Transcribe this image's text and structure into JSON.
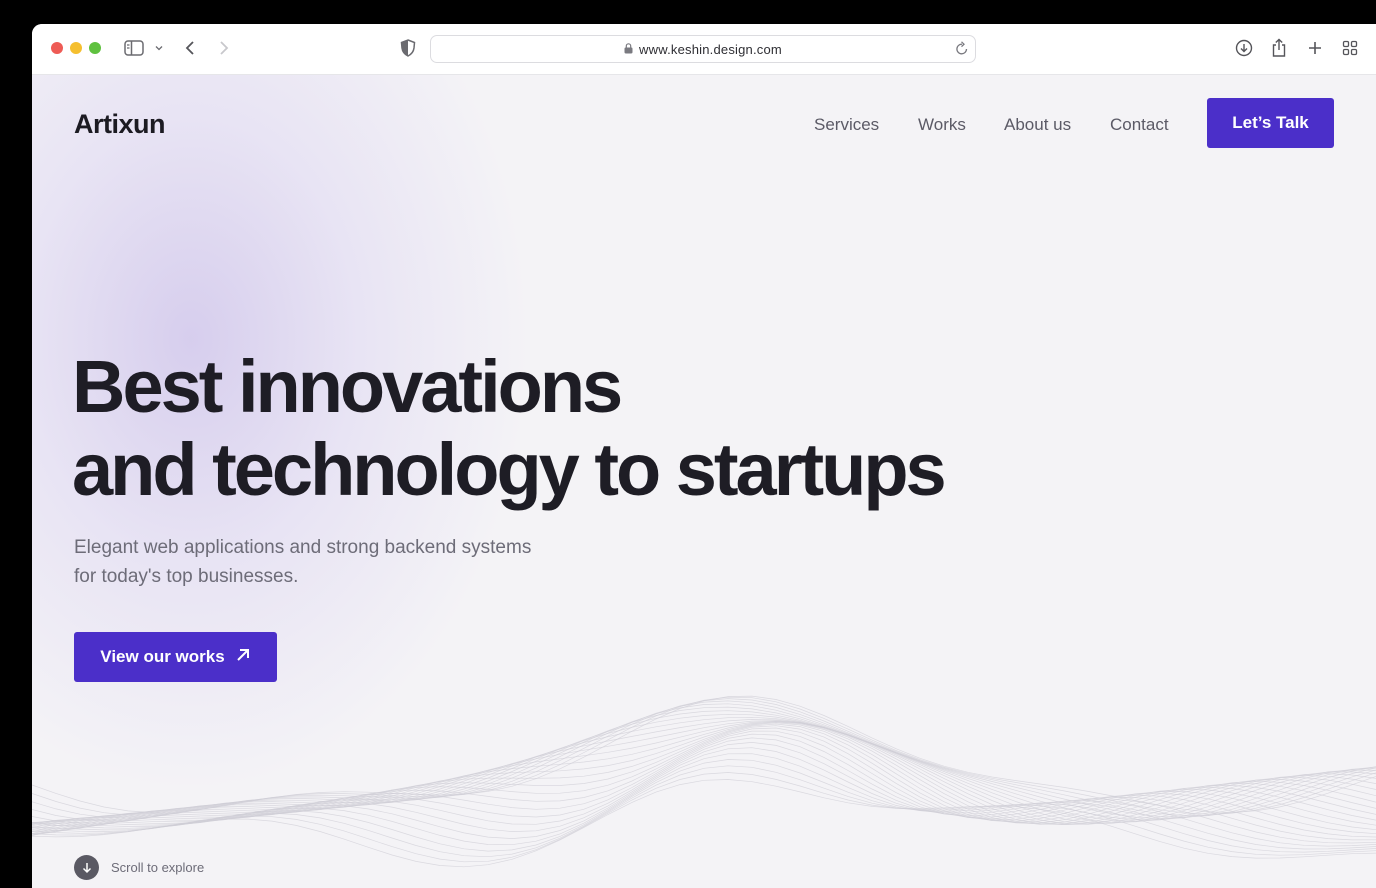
{
  "browser": {
    "url": "www.keshin.design.com",
    "icons": [
      "sidebar-icon",
      "chevron-down-icon",
      "back-icon",
      "forward-icon",
      "shield-icon",
      "lock-icon",
      "reload-icon",
      "download-icon",
      "share-icon",
      "new-tab-icon",
      "tab-overview-icon"
    ]
  },
  "site": {
    "logo": "Artixun",
    "nav": [
      "Services",
      "Works",
      "About us",
      "Contact"
    ],
    "cta": "Let’s Talk",
    "accent": "#4b2fc9"
  },
  "hero": {
    "title_line1": "Best innovations",
    "title_line2": "and technology to startups",
    "subtitle_line1": "Elegant web applications and strong backend systems",
    "subtitle_line2": "for today's top businesses.",
    "button": "View our works",
    "button_icon": "arrow-up-right-icon"
  },
  "scroll": {
    "label": "Scroll to explore",
    "icon": "arrow-down-icon"
  }
}
